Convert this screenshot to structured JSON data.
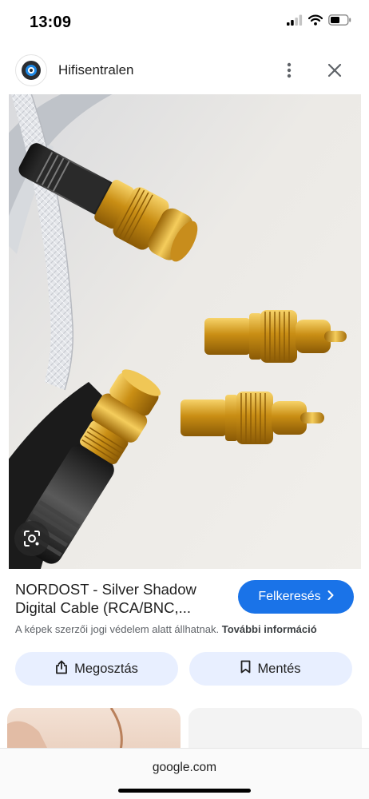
{
  "status_bar": {
    "time": "13:09",
    "signal_icon": "cellular-signal-icon",
    "wifi_icon": "wifi-icon",
    "battery_icon": "battery-icon"
  },
  "header": {
    "site_name": "Hifisentralen",
    "logo_icon": "site-logo-icon",
    "more_icon": "more-vert-icon",
    "close_icon": "close-icon"
  },
  "image": {
    "lens_icon": "google-lens-icon"
  },
  "result": {
    "title_line1": "NORDOST - Silver Shadow",
    "title_line2": "Digital Cable (RCA/BNC,...",
    "visit_button_label": "Felkeresés",
    "copyright_text": "A képek szerzői jogi védelem alatt állhatnak.",
    "more_info_link": "További információ"
  },
  "actions": {
    "share_label": "Megosztás",
    "save_label": "Mentés"
  },
  "browser": {
    "url": "google.com"
  },
  "colors": {
    "accent_blue": "#1a73e8",
    "action_bg": "#e8efff"
  }
}
